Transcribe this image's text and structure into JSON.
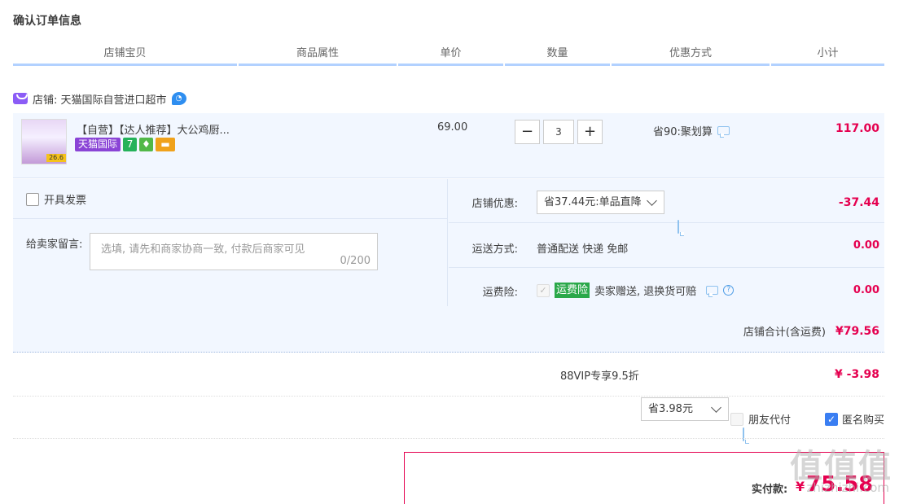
{
  "page_title": "确认订单信息",
  "table_header": [
    "店铺宝贝",
    "商品属性",
    "单价",
    "数量",
    "优惠方式",
    "小计"
  ],
  "shop": {
    "label": "店铺: 天猫国际自营进口超市"
  },
  "item": {
    "title": "【自营】【达人推荐】大公鸡厨...",
    "badges": {
      "tmall": "天猫国际",
      "seven": "7"
    },
    "thumb_price": "26.6",
    "unit_price": "69.00",
    "quantity": "3",
    "minus": "−",
    "plus": "+",
    "discount": "省90:聚划算",
    "subtotal": "117.00"
  },
  "invoice": {
    "label": "开具发票"
  },
  "message": {
    "label": "给卖家留言:",
    "placeholder": "选填, 请先和商家协商一致, 付款后商家可见",
    "counter": "0/200"
  },
  "shop_discount": {
    "label": "店铺优惠:",
    "selected": "省37.44元:单品直降",
    "amount": "-37.44"
  },
  "shipping": {
    "label": "运送方式:",
    "value": "普通配送 快递 免邮",
    "amount": "0.00"
  },
  "insurance": {
    "label": "运费险:",
    "tag": "运费险",
    "desc": "卖家赠送, 退换货可赔",
    "amount": "0.00"
  },
  "shop_total": {
    "label": "店铺合计(含运费)",
    "amount": "¥79.56"
  },
  "vip": {
    "label": "88VIP专享9.5折",
    "selected": "省3.98元",
    "amount": "¥ -3.98"
  },
  "options": {
    "friend_pay": "朋友代付",
    "anonymous": "匿名购买"
  },
  "actual_pay": {
    "label": "实付款:",
    "currency": "¥",
    "amount": "75.58"
  },
  "watermark": {
    "logo": "值值值",
    "url": "zhizhizhi.com"
  },
  "colors": {
    "accent_red": "#e5004f",
    "header_line": "#b2d1ff",
    "panel_bg": "#f2f7ff",
    "check_blue": "#3a7ef2"
  }
}
